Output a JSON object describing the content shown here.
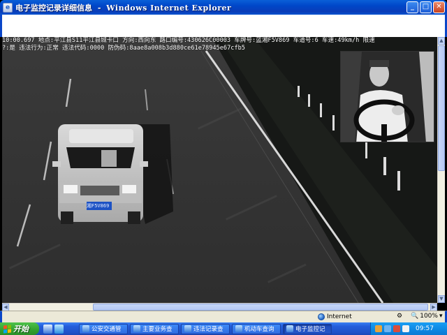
{
  "window": {
    "title_doc": "电子监控记录详细信息",
    "title_sep": "-",
    "title_app": "Windows Internet Explorer",
    "btn_minimize": "_",
    "btn_maximize": "□",
    "btn_close": "✕"
  },
  "record": {
    "line1": "10:00.697 地点:平江县S11平江县城卡口 方向:西向东 路口编号:430626C00003 车牌号:蓝湘F5V869 车道号:6 车速:49km/h 限速",
    "line2": "?:是 违法行为:正常 违法代码:0000 防伪码:8aae8a008b3d880ce61e78945e67cfb5",
    "plate_text": "湘F5V869"
  },
  "status": {
    "zone": "Internet",
    "zoom": "100%"
  },
  "taskbar": {
    "start_label": "开始",
    "buttons": [
      {
        "label": "公安交通管"
      },
      {
        "label": "主要业务查"
      },
      {
        "label": "违法记录查"
      },
      {
        "label": "机动车查询"
      },
      {
        "label": "电子监控记"
      }
    ],
    "clock": "09:57"
  },
  "colors": {
    "titlebar": "#0a4fd0",
    "taskbar": "#245edb",
    "start": "#32a12f",
    "tray": "#0f8be4",
    "plate": "#1d52c4"
  }
}
